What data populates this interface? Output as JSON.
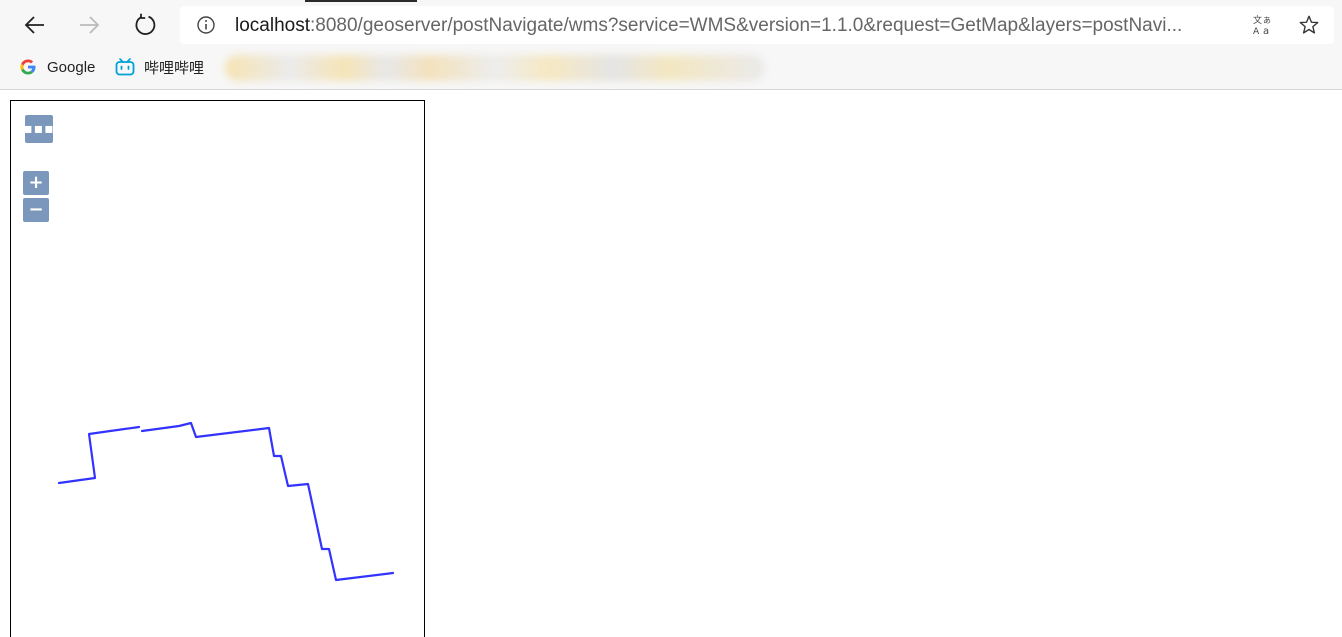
{
  "browser": {
    "url_host": "localhost",
    "url_rest": ":8080/geoserver/postNavigate/wms?service=WMS&version=1.1.0&request=GetMap&layers=postNavi...",
    "icons": {
      "back": "arrow-left-icon",
      "forward": "arrow-right-icon",
      "reload": "reload-icon",
      "info": "info-icon",
      "translate": "translate-icon",
      "star": "star-icon"
    }
  },
  "bookmarks": [
    {
      "label": "Google",
      "icon": "google-icon"
    },
    {
      "label": "哔哩哔哩",
      "icon": "bilibili-icon"
    }
  ],
  "map": {
    "controls": {
      "layer_switcher": "▪▪▪",
      "zoom_in": "+",
      "zoom_out": "−"
    },
    "line_color": "#3333ff",
    "control_color": "#7b98bc"
  }
}
